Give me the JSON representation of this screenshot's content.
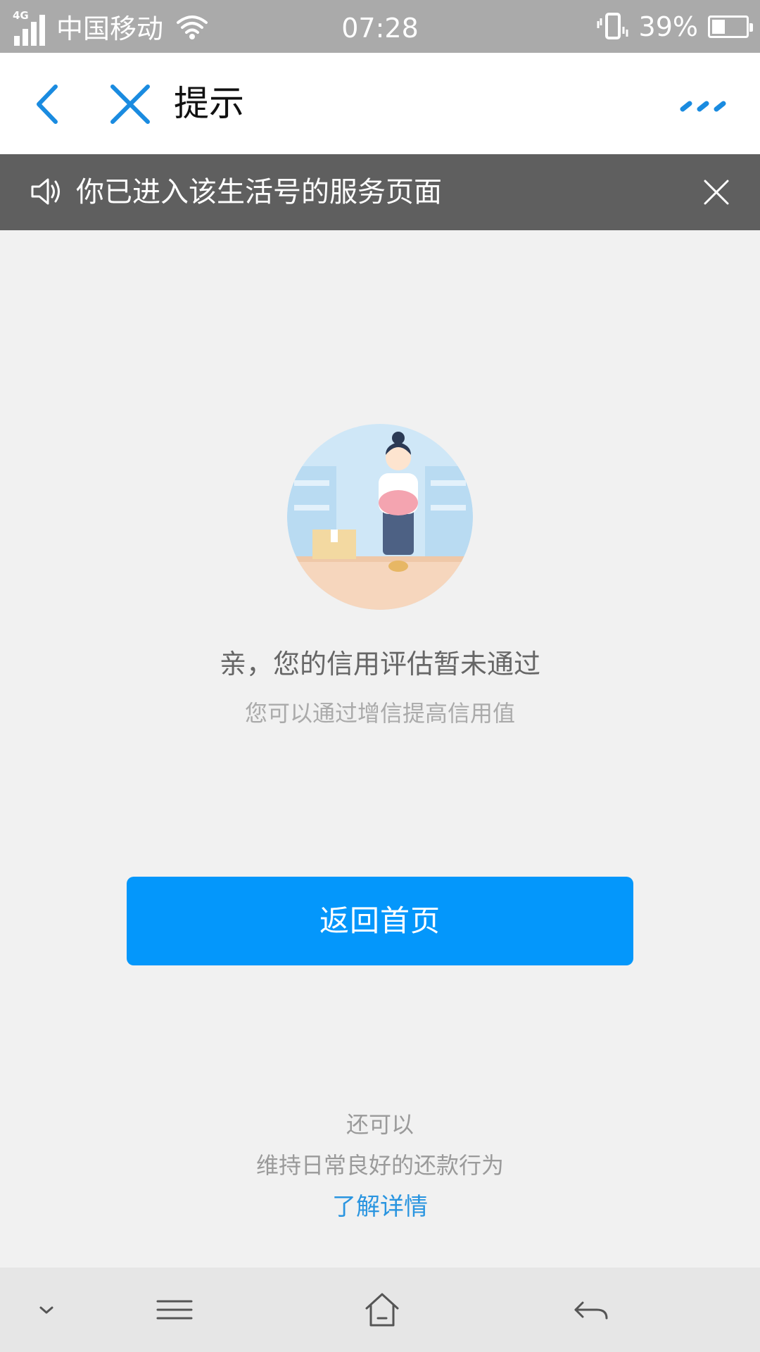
{
  "status_bar": {
    "network_tag": "4G",
    "carrier": "中国移动",
    "time": "07:28",
    "battery_percent": "39%",
    "battery_level": 0.39
  },
  "nav": {
    "title": "提示",
    "accent": "#1a8be0"
  },
  "notice": {
    "text": "你已进入该生活号的服务页面"
  },
  "message": {
    "title": "亲，您的信用评估暂未通过",
    "subtitle": "您可以通过增信提高信用值"
  },
  "primary_button": {
    "label": "返回首页",
    "color": "#0497fb"
  },
  "footer": {
    "also_label": "还可以",
    "description": "维持日常良好的还款行为",
    "link_label": "了解详情"
  },
  "icons": {
    "back": "chevron-left-icon",
    "close": "close-icon",
    "more": "more-icon",
    "speaker": "speaker-icon",
    "notice_close": "close-icon",
    "collapse": "chevron-down-icon",
    "menu": "menu-icon",
    "home": "home-icon",
    "return": "return-icon"
  }
}
